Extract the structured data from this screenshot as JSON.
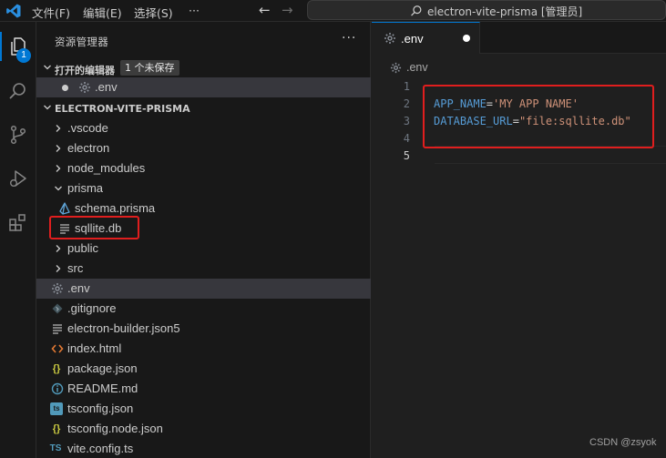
{
  "titlebar": {
    "menus": [
      "文件(F)",
      "编辑(E)",
      "选择(S)",
      "···"
    ],
    "command_center": "electron-vite-prisma [管理员]"
  },
  "activity_bar": {
    "explorer_badge": "1"
  },
  "sidebar": {
    "title": "资源管理器",
    "more": "···",
    "open_editors": {
      "label": "打开的编辑器",
      "badge": "1 个未保存",
      "items": [
        {
          "label": ".env"
        }
      ]
    },
    "project": {
      "label": "ELECTRON-VITE-PRISMA",
      "items": [
        {
          "label": ".vscode",
          "type": "folder",
          "icon": "chevron-right-icon"
        },
        {
          "label": "electron",
          "type": "folder",
          "icon": "chevron-right-icon"
        },
        {
          "label": "node_modules",
          "type": "folder",
          "icon": "chevron-right-icon"
        },
        {
          "label": "prisma",
          "type": "folder-open",
          "icon": "chevron-down-icon"
        },
        {
          "label": "schema.prisma",
          "type": "file",
          "icon": "prisma-icon"
        },
        {
          "label": "sqllite.db",
          "type": "file",
          "icon": "lines-file-icon"
        },
        {
          "label": "public",
          "type": "folder",
          "icon": "chevron-right-icon"
        },
        {
          "label": "src",
          "type": "folder",
          "icon": "chevron-right-icon"
        },
        {
          "label": ".env",
          "type": "file",
          "icon": "gear-icon"
        },
        {
          "label": ".gitignore",
          "type": "file",
          "icon": "git-icon"
        },
        {
          "label": "electron-builder.json5",
          "type": "file",
          "icon": "lines-file-icon"
        },
        {
          "label": "index.html",
          "type": "file",
          "icon": "html-icon"
        },
        {
          "label": "package.json",
          "type": "file",
          "icon": "json-icon"
        },
        {
          "label": "README.md",
          "type": "file",
          "icon": "info-icon"
        },
        {
          "label": "tsconfig.json",
          "type": "file",
          "icon": "ts-file-icon"
        },
        {
          "label": "tsconfig.node.json",
          "type": "file",
          "icon": "json-icon"
        },
        {
          "label": "vite.config.ts",
          "type": "file",
          "icon": "ts-icon"
        }
      ]
    }
  },
  "editor": {
    "tab": {
      "label": ".env"
    },
    "breadcrumb": ".env",
    "line_numbers": [
      "1",
      "2",
      "3",
      "4",
      "5"
    ],
    "lines": [
      "",
      {
        "key": "APP_NAME",
        "eq": "=",
        "value": "'MY APP NAME'"
      },
      {
        "key": "DATABASE_URL",
        "eq": "=",
        "value": "\"file:sqllite.db\""
      },
      "",
      ""
    ]
  },
  "colors": {
    "accent": "#0078d4",
    "highlight_box": "#e01e1e",
    "env_key": "#569cd6",
    "env_value": "#ce9178"
  },
  "watermark": "CSDN @zsyok"
}
